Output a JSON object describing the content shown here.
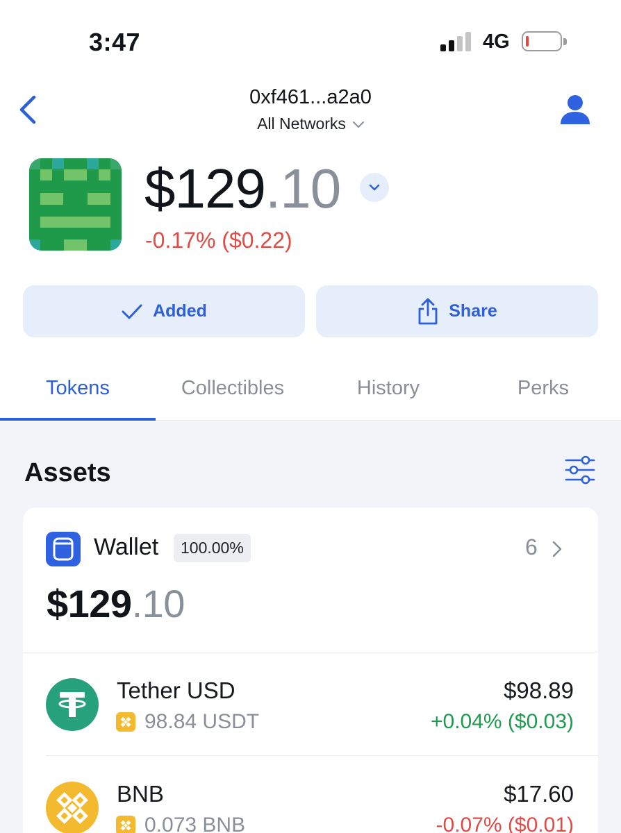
{
  "status_bar": {
    "time": "3:47",
    "network": "4G",
    "signal_bars_active": 2,
    "signal_bars_total": 4,
    "battery_level": 0.05
  },
  "header": {
    "address": "0xf461...a2a0",
    "network_selector": "All Networks",
    "icons": [
      "back-chevron-icon",
      "chevron-down-icon",
      "profile-icon"
    ]
  },
  "balance": {
    "whole": "$129",
    "decimal": ".10",
    "change": "-0.17% ($0.22)"
  },
  "actions": {
    "added_label": "Added",
    "share_label": "Share"
  },
  "tabs": [
    {
      "label": "Tokens",
      "active": true
    },
    {
      "label": "Collectibles",
      "active": false
    },
    {
      "label": "History",
      "active": false
    },
    {
      "label": "Perks",
      "active": false
    }
  ],
  "assets": {
    "title": "Assets",
    "wallet": {
      "label": "Wallet",
      "percent": "100.00%",
      "count": "6",
      "total_whole": "$129",
      "total_decimal": ".10"
    },
    "tokens": [
      {
        "name": "Tether USD",
        "amount": "98.84 USDT",
        "value": "$98.89",
        "change": "+0.04% ($0.03)",
        "trend": "positive",
        "icon": "tether-icon"
      },
      {
        "name": "BNB",
        "amount": "0.073 BNB",
        "value": "$17.60",
        "change": "-0.07% ($0.01)",
        "trend": "negative",
        "icon": "bnb-icon"
      }
    ]
  },
  "colors": {
    "accent": "#2c5fd8",
    "positive": "#1e9b4f",
    "negative": "#e04b46",
    "button_bg": "#e7eefb",
    "assets_bg": "#f3f4f9"
  }
}
